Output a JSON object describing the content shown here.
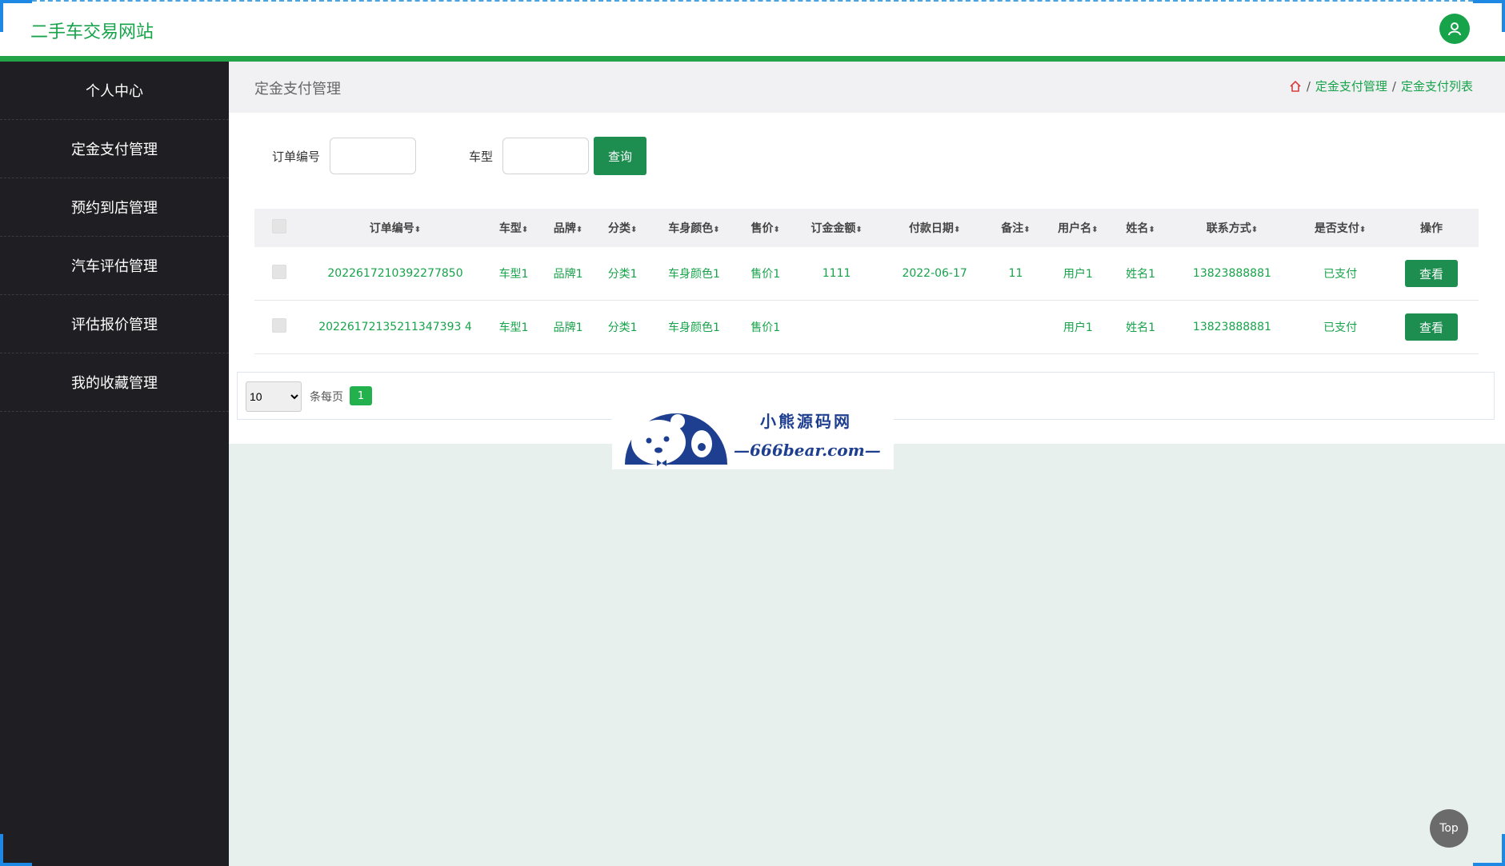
{
  "site": {
    "title": "二手车交易网站"
  },
  "sidebar": {
    "items": [
      {
        "label": "个人中心"
      },
      {
        "label": "定金支付管理"
      },
      {
        "label": "预约到店管理"
      },
      {
        "label": "汽车评估管理"
      },
      {
        "label": "评估报价管理"
      },
      {
        "label": "我的收藏管理"
      }
    ]
  },
  "page": {
    "title": "定金支付管理",
    "breadcrumb": [
      "定金支付管理",
      "定金支付列表"
    ],
    "breadcrumb_sep": "/"
  },
  "search": {
    "order_label": "订单编号",
    "car_label": "车型",
    "button": "查询"
  },
  "table": {
    "headers": [
      "订单编号",
      "车型",
      "品牌",
      "分类",
      "车身颜色",
      "售价",
      "订金金额",
      "付款日期",
      "备注",
      "用户名",
      "姓名",
      "联系方式",
      "是否支付",
      "操作"
    ],
    "sort_icon": "⬍",
    "view_label": "查看",
    "rows": [
      [
        "2022617210392277850",
        "车型1",
        "品牌1",
        "分类1",
        "车身颜色1",
        "售价1",
        "1111",
        "2022-06-17",
        "11",
        "用户1",
        "姓名1",
        "13823888881",
        "已支付"
      ],
      [
        "20226172135211347393 4",
        "车型1",
        "品牌1",
        "分类1",
        "车身颜色1",
        "售价1",
        "",
        "",
        "",
        "用户1",
        "姓名1",
        "13823888881",
        "已支付"
      ]
    ]
  },
  "pager": {
    "page_size": "10",
    "per_page_label": "条每页",
    "current_page": "1"
  },
  "watermark": {
    "line1": "小熊源码网",
    "line2": "—666bear.com—"
  },
  "top_button": "Top",
  "colors": {
    "accent": "#16a34a",
    "sidebar_bg": "#1f1f23",
    "button": "#1d8d50"
  }
}
